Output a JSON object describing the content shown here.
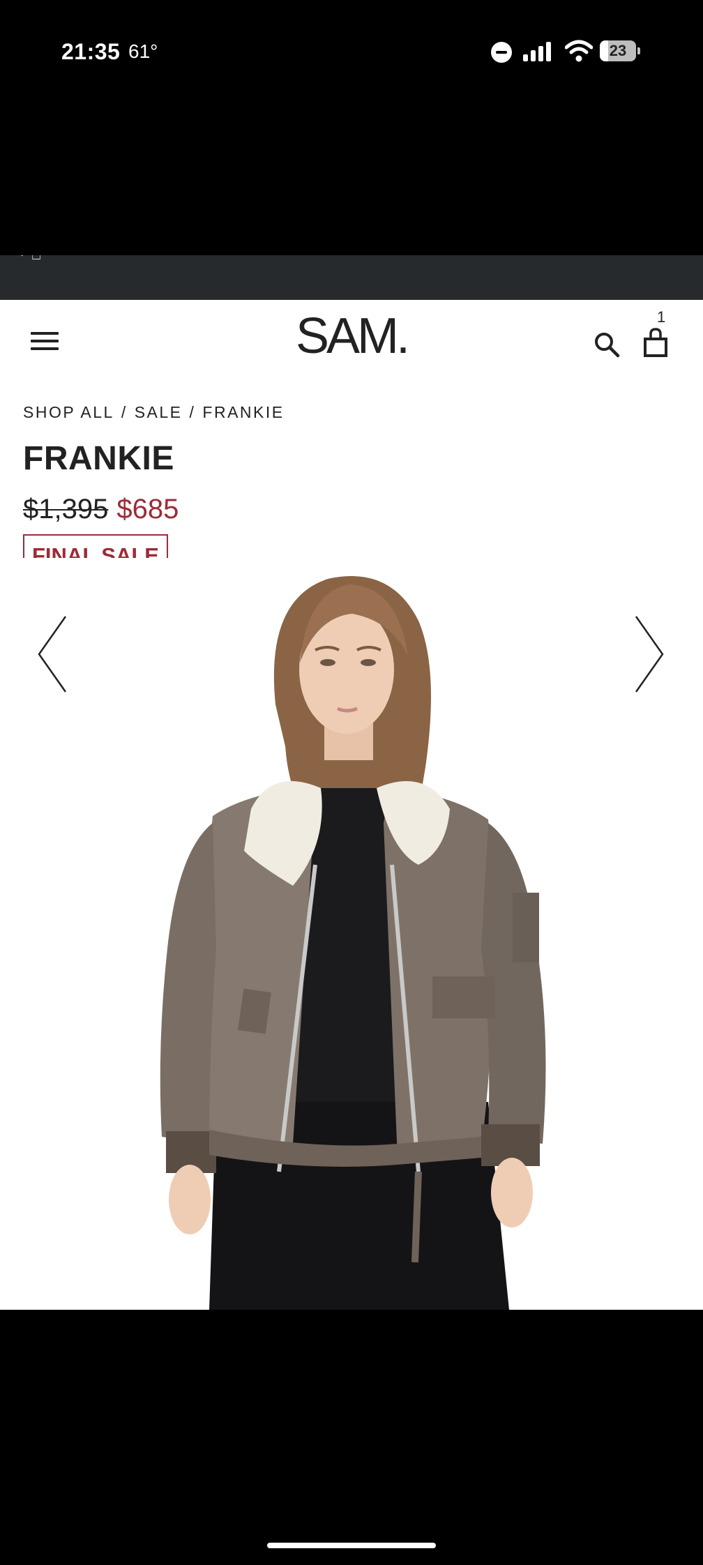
{
  "status_bar": {
    "time": "21:35",
    "temperature": "61°",
    "battery_level": "23",
    "icons": [
      "do-not-disturb-icon",
      "cellular-signal-icon",
      "wifi-icon",
      "battery-icon"
    ]
  },
  "announcement_bar": {
    "text": "· ⎕"
  },
  "header": {
    "logo": "SAM.",
    "cart_count": "1",
    "icons": [
      "menu-icon",
      "search-icon",
      "shopping-bag-icon"
    ]
  },
  "breadcrumb": {
    "items": [
      "SHOP ALL",
      "SALE",
      "FRANKIE"
    ],
    "separator": "/"
  },
  "product": {
    "title": "FRANKIE",
    "original_price": "$1,395",
    "sale_price": "$685",
    "badge": "FINAL SALE",
    "image_alt": "FRANKIE"
  },
  "carousel": {
    "icons": [
      "chevron-left-icon",
      "chevron-right-icon"
    ]
  },
  "colors": {
    "sale_red": "#9d2b36",
    "text_dark": "#222222",
    "announcement_bg": "#262a2c",
    "jacket_taupe": "#867a70",
    "collar_white": "#f1ece2"
  }
}
